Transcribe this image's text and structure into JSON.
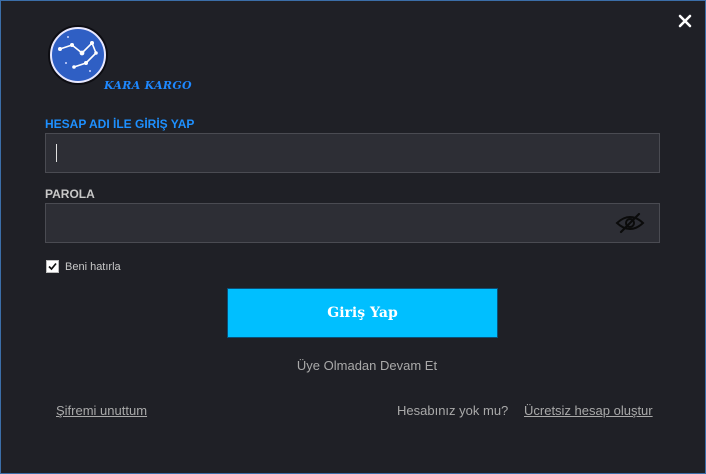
{
  "brand": {
    "name": "KARA KARGO",
    "color": "#1e88ff"
  },
  "icons": {
    "close": "close-icon",
    "logo": "constellation-logo-icon",
    "eye": "eye-slash-icon",
    "check": "check-icon"
  },
  "username": {
    "label": "HESAP ADI İLE GİRİŞ YAP",
    "value": "",
    "placeholder": ""
  },
  "password": {
    "label": "PAROLA",
    "value": "",
    "placeholder": ""
  },
  "remember": {
    "label": "Beni hatırla",
    "checked": true
  },
  "login_button": {
    "label": "Giriş Yap",
    "color": "#00bfff"
  },
  "guest_link": "Üye Olmadan Devam Et",
  "forgot_link": "Şifremi unuttum",
  "no_account_text": "Hesabınız yok mu?",
  "signup_link": "Ücretsiz hesap oluştur"
}
